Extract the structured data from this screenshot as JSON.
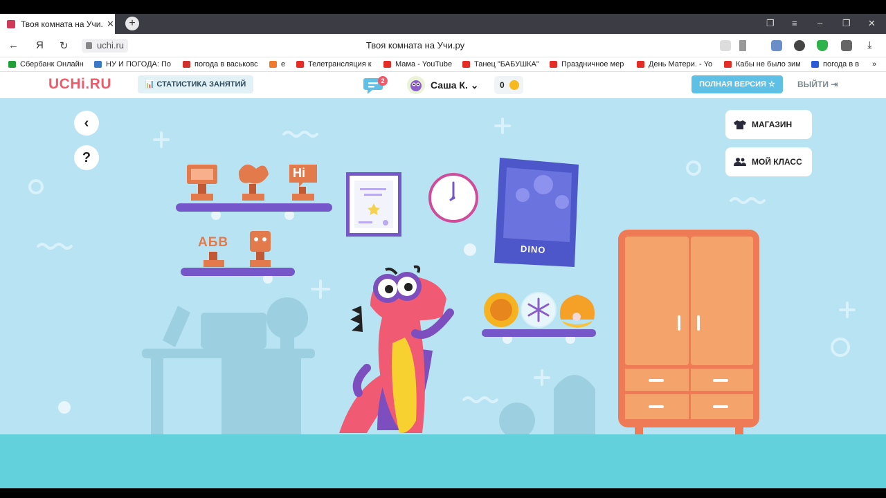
{
  "browser": {
    "tab_title": "Твоя комната на Учи.ру",
    "tab_close": "✕",
    "new_tab": "+",
    "url": "uchi.ru",
    "page_title": "Твоя комната на Учи.ру",
    "back": "←",
    "yandex": "Я",
    "reload": "↻"
  },
  "bookmarks": [
    {
      "label": "Сбербанк Онлайн",
      "color": "#21a038"
    },
    {
      "label": "НУ И ПОГОДА: По",
      "color": "#3a78c8"
    },
    {
      "label": "погода в васьковс",
      "color": "#d0312d"
    },
    {
      "label": "е",
      "color": "#f0792b"
    },
    {
      "label": "Телетрансляция к",
      "color": "#e52d27"
    },
    {
      "label": "Мама - YouTube",
      "color": "#e52d27"
    },
    {
      "label": "Танец \"БАБУШКА\"",
      "color": "#e52d27"
    },
    {
      "label": "Праздничное мер",
      "color": "#e52d27"
    },
    {
      "label": "День Матери. - Yo",
      "color": "#e52d27"
    },
    {
      "label": "Кабы не было зим",
      "color": "#e52d27"
    },
    {
      "label": "погода в в",
      "color": "#2b5bd7"
    }
  ],
  "header": {
    "logo": "UCHi.RU",
    "stats_button": "📊 СТАТИСТИКА ЗАНЯТИЙ",
    "chat_badge": "2",
    "username": "Саша К.",
    "chevron": "⌄",
    "coins": "0",
    "full_version": "ПОЛНАЯ ВЕРСИЯ ☆",
    "logout": "ВЫЙТИ ⇥"
  },
  "room": {
    "back_icon": "‹",
    "help_icon": "?",
    "shop_label": "МАГАЗИН",
    "class_label": "МОЙ КЛАСС",
    "trophy_hi": "Hi",
    "trophy_abv": "АБВ",
    "poster_title": "DINO"
  },
  "colors": {
    "brand": "#ef5b6b",
    "room_bg": "#b8e3f2",
    "floor": "#63d1dc",
    "shelf": "#7657c9",
    "wardrobe": "#f4a46a",
    "wardrobe_frame": "#ef7a56"
  }
}
